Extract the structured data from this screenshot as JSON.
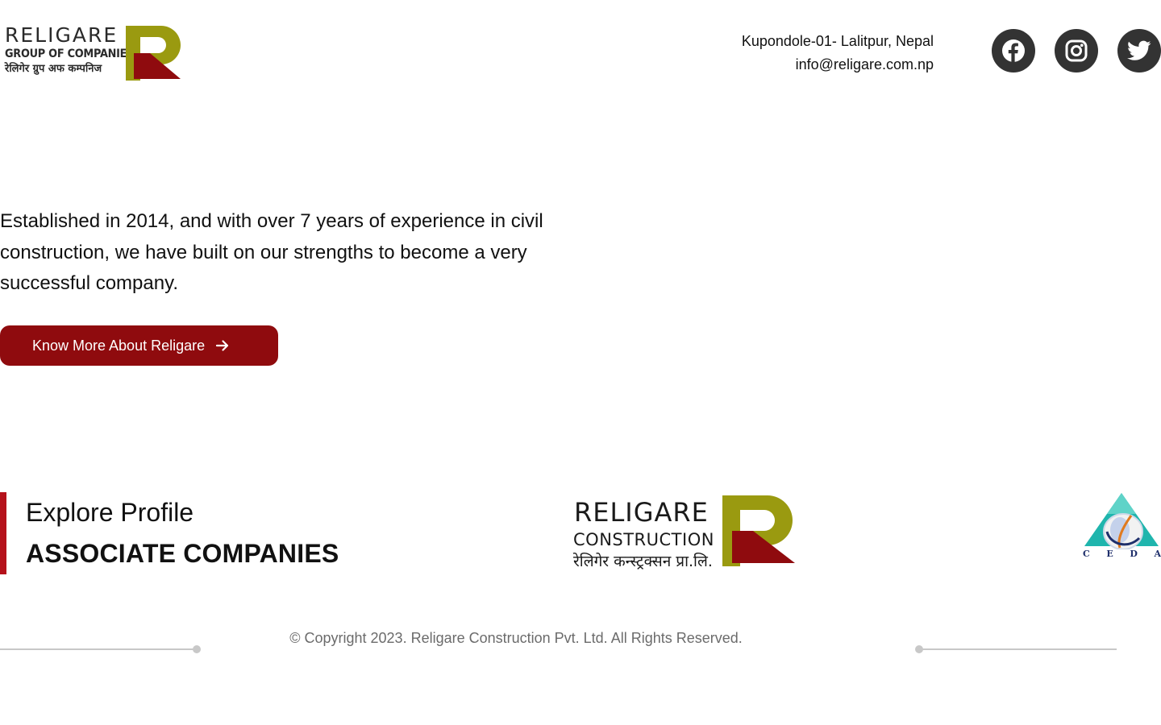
{
  "header": {
    "logo": {
      "wordmark": "RELIGARE",
      "subline": "GROUP OF COMPANIES",
      "nepali_line": "रेलिगेर ग्रुप अफ कम्पनिज"
    },
    "address": "Kupondole-01- Lalitpur, Nepal",
    "email": "info@religare.com.np",
    "social": [
      {
        "name": "facebook",
        "icon": "facebook-icon"
      },
      {
        "name": "instagram",
        "icon": "instagram-icon"
      },
      {
        "name": "twitter",
        "icon": "twitter-icon"
      }
    ]
  },
  "intro": {
    "text": "Established in 2014, and with over 7 years of experience in civil construction, we have built on our strengths to become a very successful company.",
    "cta_label": "Know More About Religare"
  },
  "associates": {
    "eyebrow": "Explore Profile",
    "title": "ASSOCIATE COMPANIES",
    "companies": [
      {
        "line1": "RELIGARE",
        "line2": "CONSTRUCTION",
        "line3": "रेलिगेर कन्स्ट्रक्सन प्रा.लि."
      },
      {
        "letters": [
          "C",
          "E",
          "D",
          "A"
        ]
      }
    ]
  },
  "footer": {
    "copyright": "© Copyright 2023. Religare Construction Pvt. Ltd. All Rights Reserved."
  },
  "colors": {
    "brand_red": "#8f0b0e",
    "accent_bar": "#b5121b",
    "olive": "#9a9a10",
    "social_bg": "#333333"
  }
}
